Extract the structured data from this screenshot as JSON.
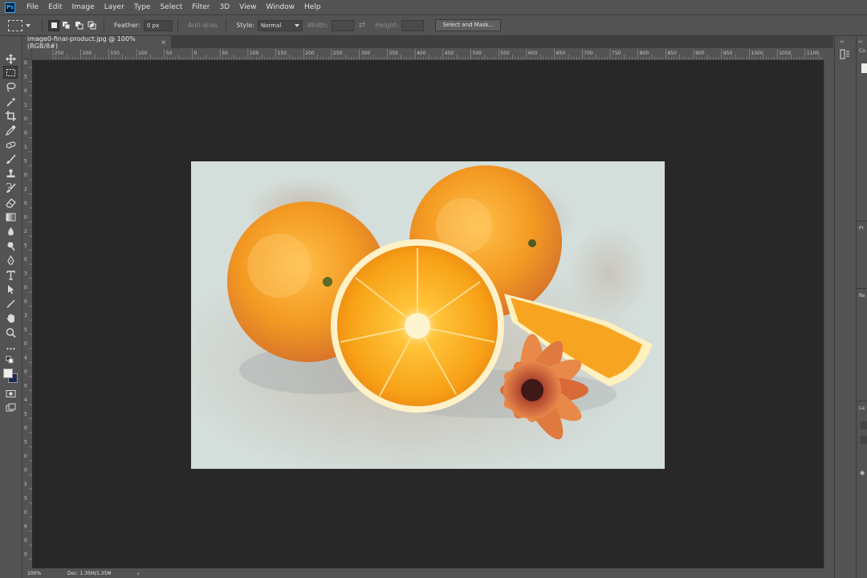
{
  "app": {
    "logo_text": "Ps",
    "accent": "#31a8ff"
  },
  "menu": {
    "items": [
      "File",
      "Edit",
      "Image",
      "Layer",
      "Type",
      "Select",
      "Filter",
      "3D",
      "View",
      "Window",
      "Help"
    ]
  },
  "options": {
    "feather_label": "Feather:",
    "feather_value": "0 px",
    "antialias_label": "Anti-alias",
    "style_label": "Style:",
    "style_value": "Normal",
    "width_label": "Width:",
    "height_label": "Height:",
    "select_mask_label": "Select and Mask..."
  },
  "document": {
    "tab_title": "image0-final-product.jpg @ 100% (RGB/8#)",
    "close_glyph": "×"
  },
  "ruler": {
    "h_ticks": [
      "250",
      "200",
      "150",
      "100",
      "50",
      "0",
      "50",
      "100",
      "150",
      "200",
      "250",
      "300",
      "350",
      "400",
      "450",
      "500",
      "550",
      "600",
      "650",
      "700",
      "750",
      "800",
      "850",
      "900",
      "950",
      "1000",
      "1050",
      "1100"
    ],
    "v_ticks": [
      "0",
      "5",
      "0",
      "1",
      "0",
      "0",
      "1",
      "5",
      "0",
      "2",
      "0",
      "0",
      "2",
      "5",
      "0",
      "3",
      "0",
      "0",
      "3",
      "5",
      "0",
      "4",
      "0",
      "0",
      "4",
      "5",
      "0",
      "5",
      "0",
      "0",
      "5",
      "5",
      "0",
      "6",
      "0",
      "0"
    ]
  },
  "status": {
    "zoom": "100%",
    "doc": "Doc: 1.35M/1.35M",
    "arrow": "›"
  },
  "panels": {
    "tabs": [
      "Co",
      "Pr",
      "Re",
      "La"
    ]
  },
  "tools": [
    "move-tool",
    "marquee-tool",
    "lasso-tool",
    "magic-wand-tool",
    "crop-tool",
    "eyedropper-tool",
    "healing-tool",
    "brush-tool",
    "stamp-tool",
    "history-brush-tool",
    "eraser-tool",
    "gradient-tool",
    "blur-tool",
    "dodge-tool",
    "pen-tool",
    "type-tool",
    "path-select-tool",
    "line-tool",
    "hand-tool",
    "zoom-tool",
    "more-tools"
  ],
  "colors": {
    "foreground": "#ecece8",
    "background": "#1a2a55",
    "canvas_bg": "#282828",
    "ui_bg": "#535353"
  }
}
